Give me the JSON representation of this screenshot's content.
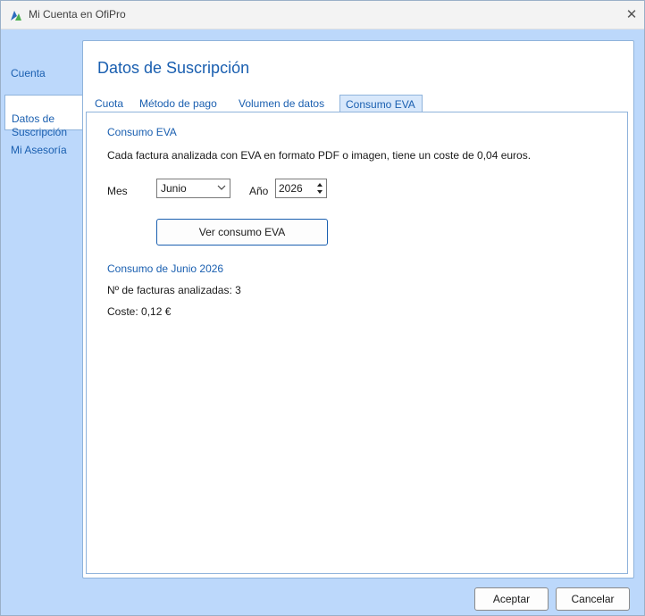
{
  "window": {
    "title": "Mi Cuenta en OfiPro"
  },
  "sidebar": {
    "items": [
      {
        "label": "Cuenta"
      },
      {
        "label": "Datos de\nSuscripción"
      },
      {
        "label": "Mi Asesoría"
      }
    ]
  },
  "panel": {
    "title": "Datos de Suscripción"
  },
  "tabs": [
    {
      "label": "Cuota"
    },
    {
      "label": "Método de pago"
    },
    {
      "label": "Volumen de datos"
    },
    {
      "label": "Consumo EVA"
    }
  ],
  "eva": {
    "section_title": "Consumo EVA",
    "description": "Cada factura analizada con EVA en formato PDF o imagen, tiene un coste de 0,04 euros.",
    "month_label": "Mes",
    "month_value": "Junio",
    "year_label": "Año",
    "year_value": "2026",
    "view_button": "Ver consumo EVA",
    "result_title": "Consumo de Junio 2026",
    "invoices_text": "Nº de facturas analizadas: 3",
    "cost_text": "Coste: 0,12 €"
  },
  "footer": {
    "accept": "Aceptar",
    "cancel": "Cancelar"
  },
  "colors": {
    "accent": "#1a5fb0",
    "background": "#bcd8fb",
    "tab_active": "#d8e8fb"
  },
  "icons": [
    "app-logo-icon",
    "close-icon",
    "chevron-down-icon",
    "spin-up-icon",
    "spin-down-icon"
  ]
}
